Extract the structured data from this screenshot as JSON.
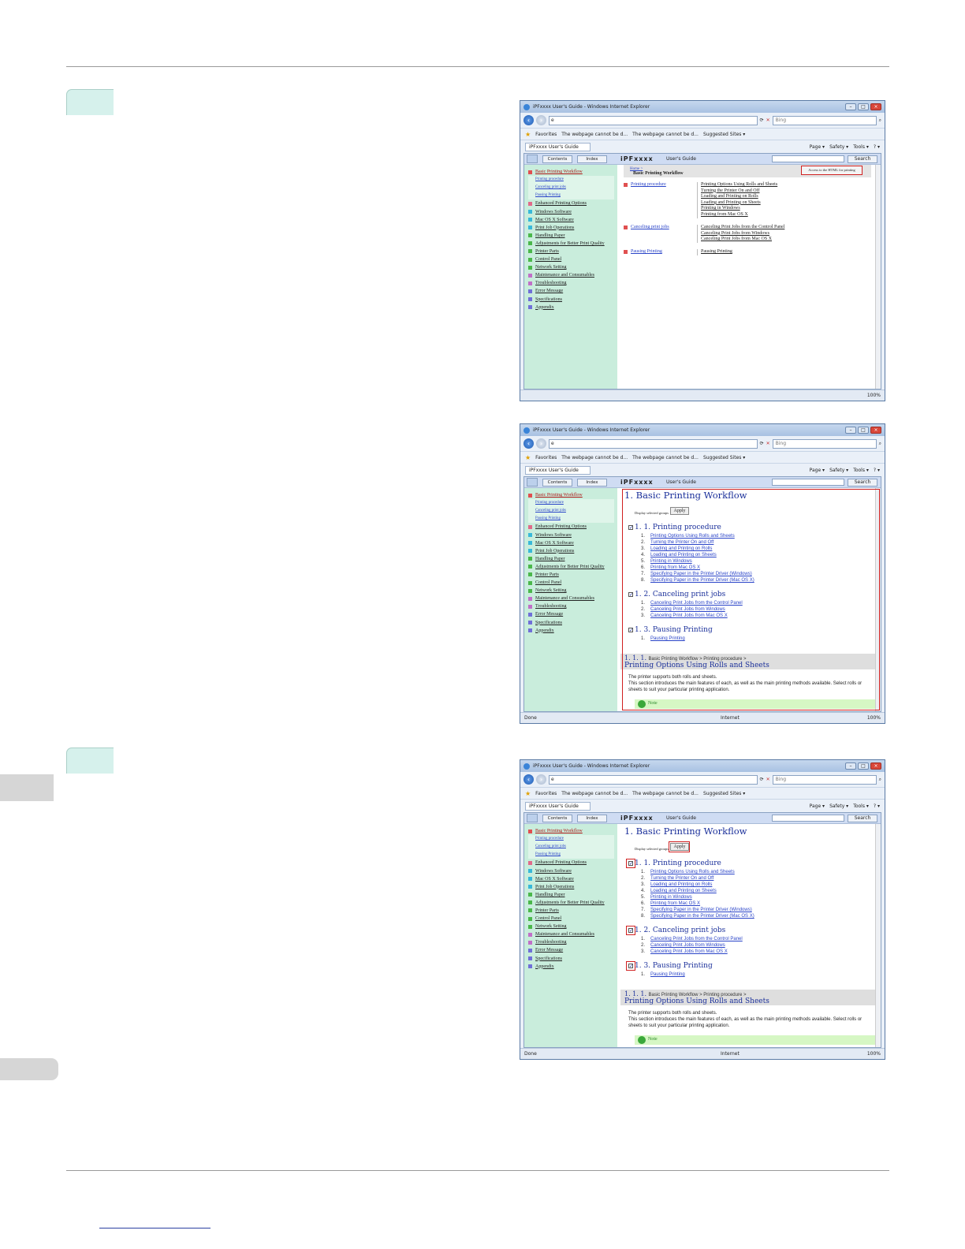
{
  "browser": {
    "window_title": "iPFxxxx  User's Guide - Windows Internet Explorer",
    "address_value": "e",
    "search_placeholder": "Bing",
    "favorites_label": "Favorites",
    "fav_item1": "The webpage cannot be d...",
    "fav_item2": "The webpage cannot be d...",
    "fav_item3": "Suggested Sites ▾",
    "tab_label": "iPFxxxx  User's Guide",
    "tools": [
      "Page ▾",
      "Safety ▾",
      "Tools ▾",
      "? ▾"
    ],
    "status_done": "Done",
    "status_zone": "Internet",
    "zoom": "100%"
  },
  "guide": {
    "contents_tab": "Contents",
    "index_tab": "Index",
    "logo": "iPFxxxx",
    "users_guide": "User's Guide",
    "search_button": "Search"
  },
  "toc": {
    "top": "Basic Printing Workflow",
    "subs": [
      "Printing procedure",
      "Canceling print jobs",
      "Pausing Printing"
    ],
    "items": [
      {
        "label": "Enhanced Printing Options",
        "color": "#e06b8a"
      },
      {
        "label": "Windows Software",
        "color": "#38b9d9"
      },
      {
        "label": "Mac OS X Software",
        "color": "#38b9d9"
      },
      {
        "label": "Print Job Operations",
        "color": "#38b9d9"
      },
      {
        "label": "Handling Paper",
        "color": "#4bb84b"
      },
      {
        "label": "Adjustments for Better Print Quality",
        "color": "#4bb84b"
      },
      {
        "label": "Printer Parts",
        "color": "#4bb84b"
      },
      {
        "label": "Control Panel",
        "color": "#4bb84b"
      },
      {
        "label": "Network Setting",
        "color": "#4bb84b"
      },
      {
        "label": "Maintenance and Consumables",
        "color": "#c070c8"
      },
      {
        "label": "Troubleshooting",
        "color": "#c070c8"
      },
      {
        "label": "Error Message",
        "color": "#7070d8"
      },
      {
        "label": "Specifications",
        "color": "#7070d8"
      },
      {
        "label": "Appendix",
        "color": "#7070d8"
      }
    ]
  },
  "shot1": {
    "breadcrumb": "Home >",
    "title": "Basic Printing Workflow",
    "html_button": "Access to the HTML for printing",
    "sections": [
      {
        "name": "Printing procedure",
        "items": [
          "Printing Options Using Rolls and Sheets",
          "Turning the Printer On and Off",
          "Loading and Printing on Rolls",
          "Loading and Printing on Sheets",
          "Printing in Windows",
          "Printing from Mac OS X"
        ]
      },
      {
        "name": "Canceling print jobs",
        "items": [
          "Canceling Print Jobs from the Control Panel",
          "Canceling Print Jobs from Windows",
          "Canceling Print Jobs from Mac OS X"
        ]
      },
      {
        "name": "Pausing Printing",
        "items": [
          "Pausing Printing"
        ]
      }
    ]
  },
  "printpage": {
    "h1": "1. Basic Printing Workflow",
    "display_label": "Display selected groups",
    "apply": "Apply",
    "check": "✓",
    "sec1": "1. 1. Printing procedure",
    "sec1_items": [
      "Printing Options Using Rolls and Sheets",
      "Turning the Printer On and Off",
      "Loading and Printing on Rolls",
      "Loading and Printing on Sheets",
      "Printing in Windows",
      "Printing from Mac OS X",
      "Specifying Paper in the Printer Driver (Windows)",
      "Specifying Paper in the Printer Driver (Mac OS X)"
    ],
    "sec2": "1. 2. Canceling print jobs",
    "sec2_items": [
      "Canceling Print Jobs from the Control Panel",
      "Canceling Print Jobs from Windows",
      "Canceling Print Jobs from Mac OS X"
    ],
    "sec3": "1. 3. Pausing Printing",
    "sec3_items": [
      "Pausing Printing"
    ],
    "sub_num": "1. 1. 1.",
    "sub_path": "Basic Printing Workflow > Printing procedure >",
    "sub_title": "Printing Options Using Rolls and Sheets",
    "para1": "The printer supports both rolls and sheets.",
    "para2": "This section introduces the main features of each, as well as the main printing methods available. Select rolls or sheets to suit your particular printing application.",
    "note": "Note"
  }
}
